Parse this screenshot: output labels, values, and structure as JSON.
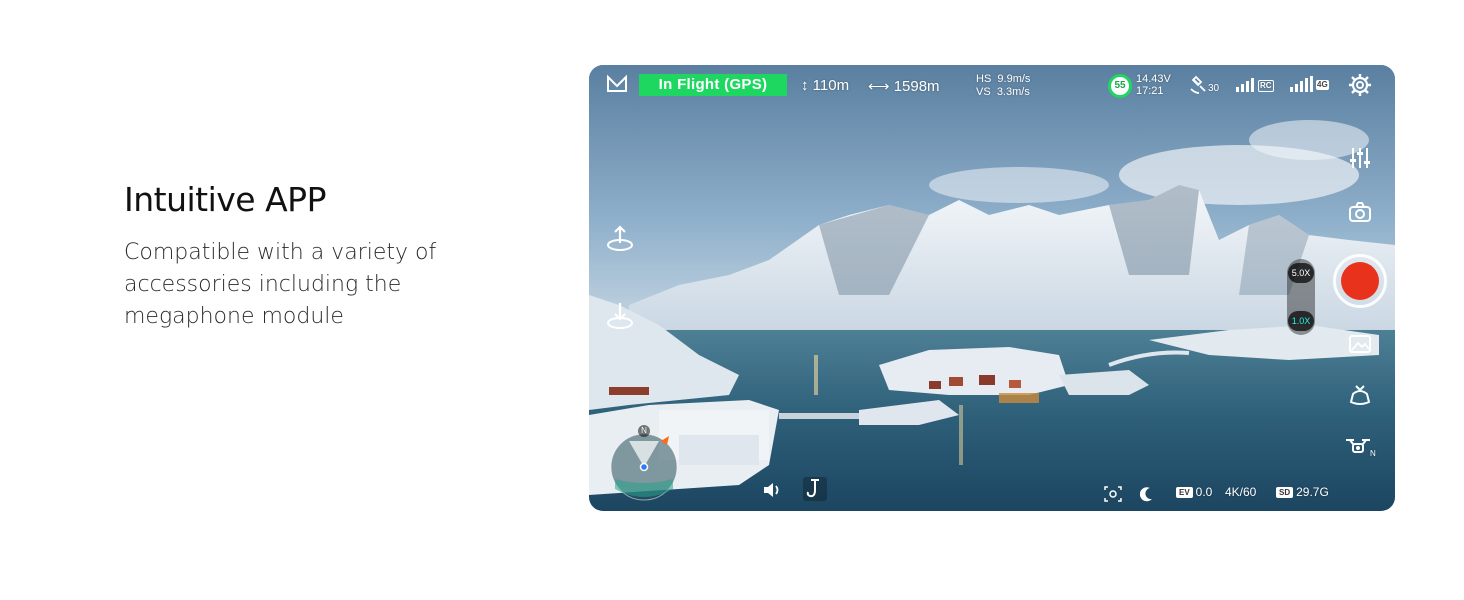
{
  "promo": {
    "title": "Intuitive APP",
    "lines": [
      "Compatible with a variety of",
      "accessories including the",
      "megaphone module"
    ]
  },
  "hud": {
    "flight_status": "In Flight (GPS)",
    "altitude": "110m",
    "distance": "1598m",
    "hs_label": "HS",
    "hs_value": "9.9m/s",
    "vs_label": "VS",
    "vs_value": "3.3m/s",
    "battery_percent": "55",
    "battery_voltage": "14.43V",
    "flight_time": "17:21",
    "satellites": "30",
    "rc_label": "RC",
    "net_label": "4G",
    "zoom_high": "5.0X",
    "zoom_low": "1.0X",
    "compass_north": "N",
    "drone_mode": "N",
    "ev_label": "EV",
    "ev_value": "0.0",
    "resolution": "4K/60",
    "sd_label": "SD",
    "storage": "29.7G",
    "accent_color": "#1ed760",
    "record_color": "#e8321c"
  },
  "icons": [
    "brand-icon",
    "altitude-icon",
    "distance-icon",
    "satellite-icon",
    "rc-signal-icon",
    "cellular-signal-icon",
    "settings-icon",
    "sliders-icon",
    "camera-switch-icon",
    "gallery-icon",
    "gimbal-icon",
    "drone-icon",
    "takeoff-icon",
    "land-icon",
    "speaker-icon",
    "hook-icon",
    "vision-icon",
    "night-mode-icon"
  ]
}
